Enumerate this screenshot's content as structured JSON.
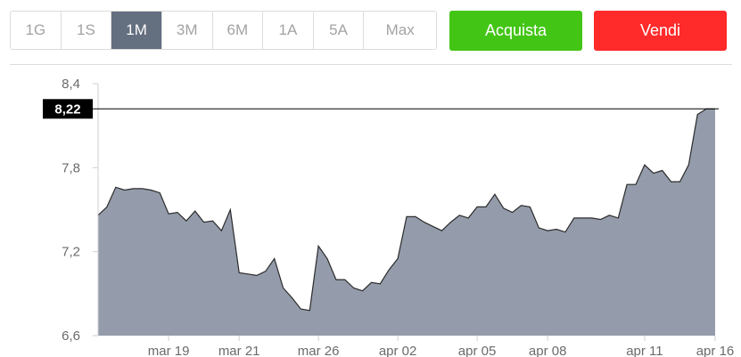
{
  "ranges": [
    {
      "label": "1G",
      "active": false
    },
    {
      "label": "1S",
      "active": false
    },
    {
      "label": "1M",
      "active": true
    },
    {
      "label": "3M",
      "active": false
    },
    {
      "label": "6M",
      "active": false
    },
    {
      "label": "1A",
      "active": false
    },
    {
      "label": "5A",
      "active": false
    },
    {
      "label": "Max",
      "active": false
    }
  ],
  "actions": {
    "buy_label": "Acquista",
    "sell_label": "Vendi",
    "buy_color": "#43c516",
    "sell_color": "#ff2a2a"
  },
  "chart_data": {
    "type": "area",
    "current_price_label": "8,22",
    "current_price": 8.22,
    "ylim": [
      6.6,
      8.4
    ],
    "y_ticks": [
      {
        "value": 8.4,
        "label": "8,4"
      },
      {
        "value": 7.8,
        "label": "7,8"
      },
      {
        "value": 7.2,
        "label": "7,2"
      },
      {
        "value": 6.6,
        "label": "6,6"
      }
    ],
    "x_tick_labels": [
      {
        "index": 8,
        "label": "mar 19"
      },
      {
        "index": 16,
        "label": "mar 21"
      },
      {
        "index": 25,
        "label": "mar 26"
      },
      {
        "index": 34,
        "label": "apr 02"
      },
      {
        "index": 43,
        "label": "apr 05"
      },
      {
        "index": 51,
        "label": "apr 08"
      },
      {
        "index": 62,
        "label": "apr 11"
      },
      {
        "index": 70,
        "label": "apr 16"
      }
    ],
    "values": [
      7.46,
      7.52,
      7.66,
      7.64,
      7.65,
      7.65,
      7.64,
      7.62,
      7.47,
      7.48,
      7.42,
      7.49,
      7.41,
      7.42,
      7.35,
      7.5,
      7.05,
      7.04,
      7.03,
      7.06,
      7.15,
      6.94,
      6.87,
      6.79,
      6.78,
      7.24,
      7.15,
      7.0,
      7.0,
      6.94,
      6.92,
      6.98,
      6.97,
      7.07,
      7.15,
      7.45,
      7.45,
      7.41,
      7.38,
      7.35,
      7.41,
      7.46,
      7.44,
      7.52,
      7.52,
      7.61,
      7.51,
      7.48,
      7.53,
      7.52,
      7.37,
      7.35,
      7.36,
      7.34,
      7.44,
      7.44,
      7.44,
      7.43,
      7.46,
      7.44,
      7.68,
      7.68,
      7.82,
      7.76,
      7.78,
      7.7,
      7.7,
      7.82,
      8.18,
      8.22,
      8.22
    ],
    "colors": {
      "area_fill": "#949cab",
      "line": "#2b2b2b",
      "price_line": "#000000",
      "label_bg": "#000000"
    }
  }
}
